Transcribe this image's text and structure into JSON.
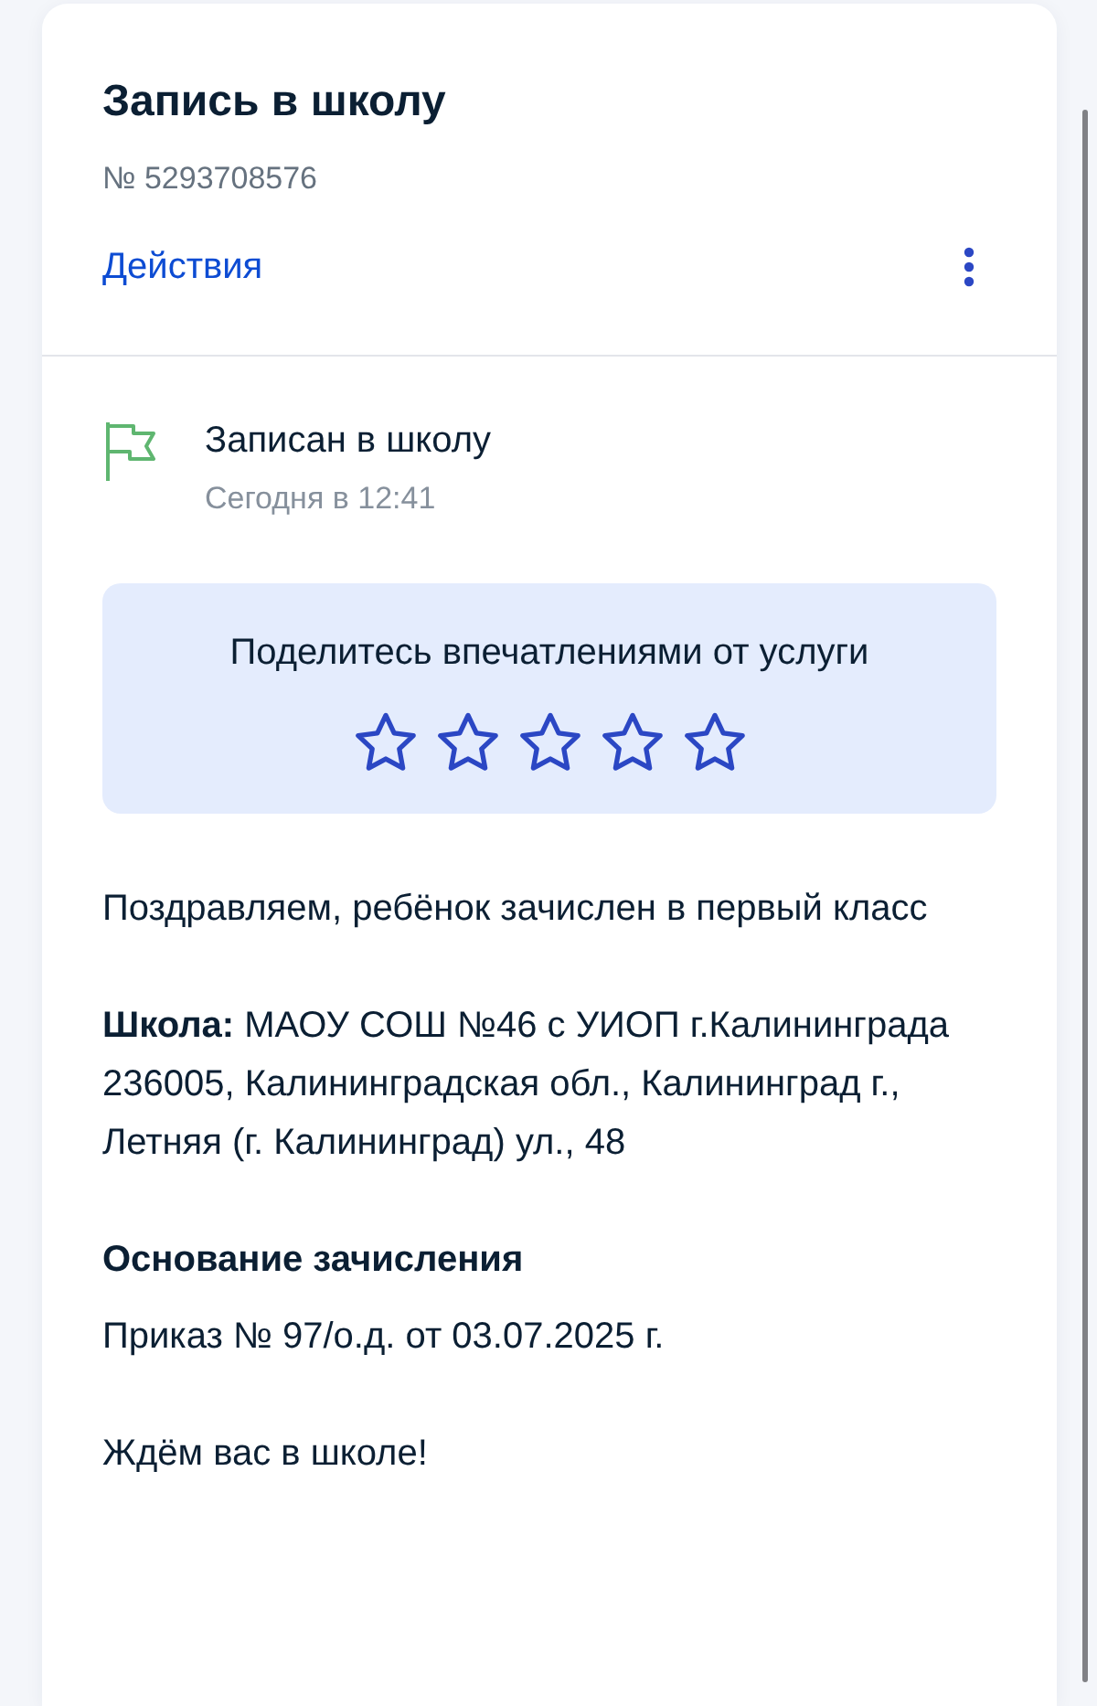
{
  "header": {
    "title": "Запись в школу",
    "number": "№ 5293708576",
    "actions_link": "Действия"
  },
  "status": {
    "label": "Записан в школу",
    "time": "Сегодня в 12:41"
  },
  "rating": {
    "prompt": "Поделитесь впечатлениями от услуги",
    "stars": 0
  },
  "body": [
    {
      "kind": "paragraph",
      "text": "Поздравляем, ребёнок зачислен в первый класс"
    },
    {
      "kind": "paragraph",
      "text": "**Школа:** МАОУ СОШ №46 с УИОП г.Калининграда 236005, Калининградская обл., Калининград г., Летняя (г. Калининград) ул., 48"
    },
    {
      "kind": "heading",
      "text": "Основание зачисления"
    },
    {
      "kind": "paragraph",
      "text": "Приказ № 97/о.д. от 03.07.2025 г."
    },
    {
      "kind": "paragraph",
      "text": "Ждём вас в школе!"
    }
  ]
}
